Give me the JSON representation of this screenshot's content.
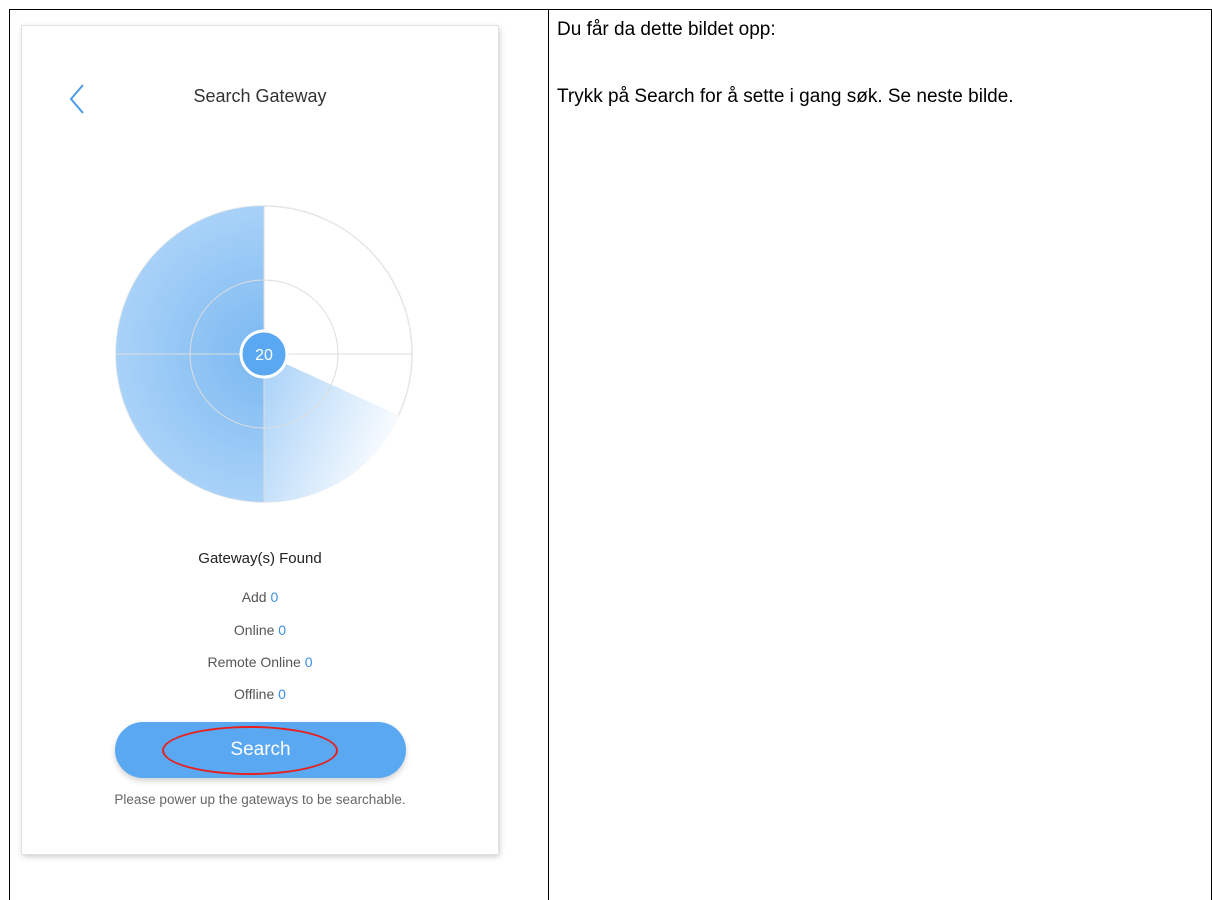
{
  "document": {
    "right_cell": {
      "line1": "Du får da dette bildet opp:",
      "line2": "Trykk på Search for å sette i gang søk. Se neste bilde."
    }
  },
  "app": {
    "title": "Search Gateway",
    "back_icon": "chevron-left-icon",
    "radar": {
      "count": "20"
    },
    "found_title": "Gateway(s) Found",
    "stats": [
      {
        "label": "Add",
        "value": "0"
      },
      {
        "label": "Online",
        "value": "0"
      },
      {
        "label": "Remote Online",
        "value": "0"
      },
      {
        "label": "Offline",
        "value": "0"
      }
    ],
    "search_button_label": "Search",
    "hint": "Please power up the gateways to be searchable."
  },
  "colors": {
    "accent": "#5aa8f2",
    "stat_value": "#3b8fe8",
    "annotation": "#e8201d"
  }
}
